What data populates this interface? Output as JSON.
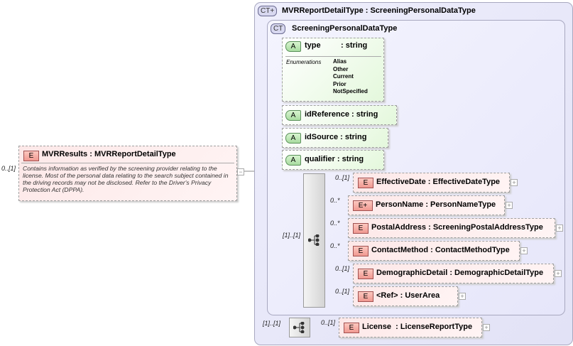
{
  "root": {
    "badge": "E",
    "name": "MVRResults",
    "type": "MVRReportDetailType",
    "multiplicity": "0..[1]",
    "doc": "Contains information as verified by the screening provider relating to the license. Most of the personal data relating to the search subject contained in the  driving records may not be disclosed. Refer to the Driver's  Privacy Protection Act (DPPA)."
  },
  "outer_type": {
    "badge": "CT+",
    "title": "MVRReportDetailType : ScreeningPersonalDataType"
  },
  "inner_type": {
    "badge": "CT",
    "title": "ScreeningPersonalDataType"
  },
  "attributes": [
    {
      "badge": "A",
      "name": "type",
      "type": ": string",
      "enum_label": "Enumerations",
      "enums": [
        "Alias",
        "Other",
        "Current",
        "Prior",
        "NotSpecified"
      ]
    },
    {
      "badge": "A",
      "name": "idReference",
      "type": ": string"
    },
    {
      "badge": "A",
      "name": "idSource",
      "type": ": string"
    },
    {
      "badge": "A",
      "name": "qualifier",
      "type": ": string"
    }
  ],
  "sequence_multiplicity": "[1]..[1]",
  "elements": [
    {
      "badge": "E",
      "name": "EffectiveDate",
      "type": ": EffectiveDateType",
      "mult": "0..[1]"
    },
    {
      "badge": "E+",
      "name": "PersonName",
      "type": ": PersonNameType",
      "mult": "0..*"
    },
    {
      "badge": "E",
      "name": "PostalAddress",
      "type": ": ScreeningPostalAddressType",
      "mult": "0..*"
    },
    {
      "badge": "E",
      "name": "ContactMethod",
      "type": ": ContactMethodType",
      "mult": "0..*"
    },
    {
      "badge": "E",
      "name": "DemographicDetail",
      "type": ": DemographicDetailType",
      "mult": "0..[1]"
    },
    {
      "badge": "E",
      "name": "<Ref>",
      "type": ": UserArea",
      "mult": "0..[1]"
    }
  ],
  "outer_sequence_multiplicity": "[1]..[1]",
  "license": {
    "badge": "E",
    "name": "License",
    "type": ": LicenseReportType",
    "mult": "0..[1]"
  }
}
